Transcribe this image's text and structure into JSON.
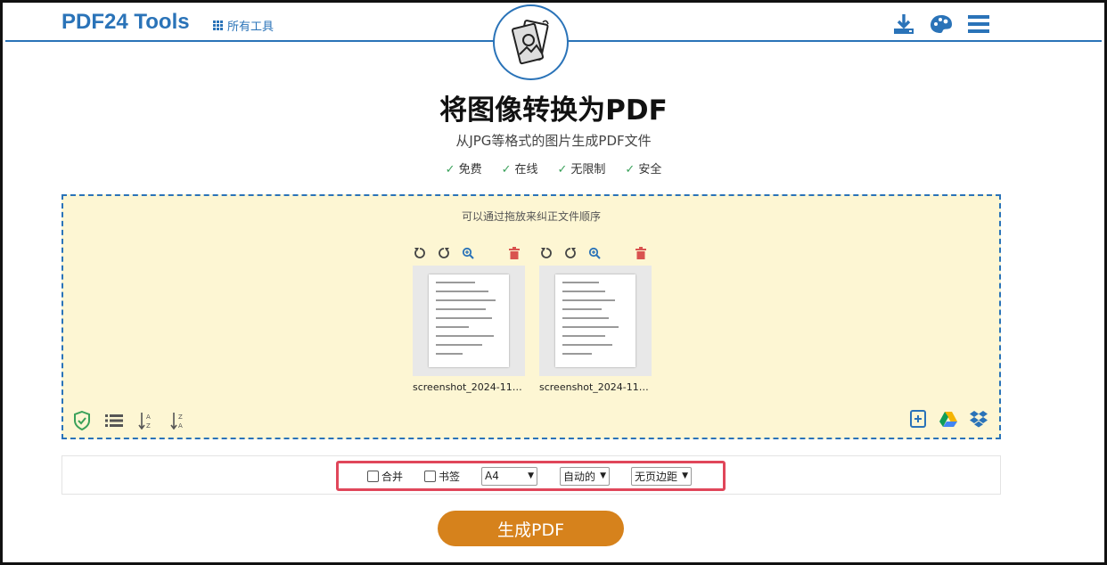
{
  "header": {
    "brand": "PDF24 Tools",
    "all_tools": "所有工具",
    "icons": [
      "download-icon",
      "palette-icon",
      "menu-icon"
    ]
  },
  "hero": {
    "title": "将图像转换为PDF",
    "subtitle": "从JPG等格式的图片生成PDF文件",
    "features": [
      "免费",
      "在线",
      "无限制",
      "安全"
    ],
    "check_mark": "✓"
  },
  "dropzone": {
    "hint": "可以通过拖放来纠正文件顺序",
    "files": [
      {
        "name": "screenshot_2024-11-1..."
      },
      {
        "name": "screenshot_2024-11-1..."
      }
    ],
    "file_tool_icons": [
      "rotate-left-icon",
      "rotate-right-icon",
      "zoom-icon",
      "delete-icon"
    ],
    "left_icons": [
      "shield-check-icon",
      "list-view-icon",
      "sort-az-icon",
      "sort-za-icon"
    ],
    "right_icons": [
      "add-file-icon",
      "google-drive-icon",
      "dropbox-icon"
    ]
  },
  "options": {
    "merge_label": "合并",
    "bookmark_label": "书签",
    "page_size": "A4",
    "orientation": "自动的",
    "margin": "无页边距"
  },
  "generate_button": "生成PDF",
  "colors": {
    "brand_blue": "#2a73b8",
    "dropzone_bg": "#fdf6d3",
    "highlight": "#e0465a",
    "button": "#d6821c",
    "check_green": "#3aa15a",
    "delete_red": "#d9534f"
  }
}
